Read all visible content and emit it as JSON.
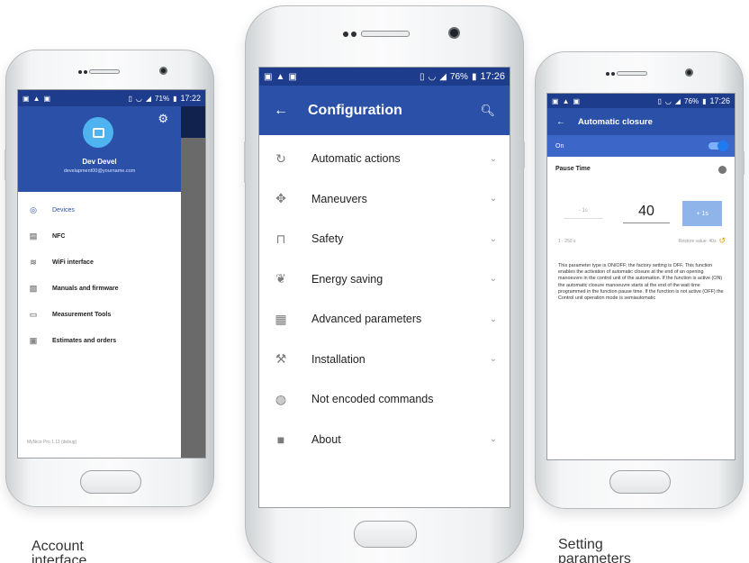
{
  "left_phone": {
    "status_time": "17:22",
    "status_battery": "71%",
    "user": {
      "name": "Dev Devel",
      "email": "develapment00@yourname.com"
    },
    "menu": [
      {
        "label": "Devices",
        "icon": "devices-icon",
        "active": true
      },
      {
        "label": "NFC",
        "icon": "nfc-icon",
        "active": false
      },
      {
        "label": "WiFi interface",
        "icon": "wifi-icon",
        "active": false
      },
      {
        "label": "Manuals and firmware",
        "icon": "manuals-icon",
        "active": false
      },
      {
        "label": "Measurement Tools",
        "icon": "ruler-icon",
        "active": false
      },
      {
        "label": "Estimates and orders",
        "icon": "orders-icon",
        "active": false
      }
    ],
    "version": "MyNice Pro 1.11 (debug)"
  },
  "center_phone": {
    "status_time": "17:26",
    "status_battery": "76%",
    "title": "Configuration",
    "items": [
      {
        "label": "Automatic actions",
        "icon": "sync-icon",
        "chevron": true
      },
      {
        "label": "Maneuvers",
        "icon": "move-icon",
        "chevron": true
      },
      {
        "label": "Safety",
        "icon": "lock-icon",
        "chevron": true
      },
      {
        "label": "Energy saving",
        "icon": "leaf-icon",
        "chevron": true
      },
      {
        "label": "Advanced parameters",
        "icon": "sliders-icon",
        "chevron": true
      },
      {
        "label": "Installation",
        "icon": "wrench-icon",
        "chevron": true
      },
      {
        "label": "Not encoded commands",
        "icon": "globe-icon",
        "chevron": false
      },
      {
        "label": "About",
        "icon": "folder-icon",
        "chevron": true
      }
    ]
  },
  "right_phone": {
    "status_time": "17:26",
    "status_battery": "76%",
    "title": "Automatic closure",
    "on_label": "On",
    "toggle_on": true,
    "pause_label": "Pause Time",
    "minus_label": "- 1s",
    "value": "40",
    "plus_label": "+ 1s",
    "range": "1 - 250 s",
    "restore_label": "Restore value: 40s",
    "description": "This parameter type is ON/OFF; the factory setting is OFF. This function enables the activation of automatic closure at the end of an opening manoeuvre in the control unit of the automation. If the function is active (ON) the automatic closure manoeuvre starts at the end of the wait time programmed in the function pause time. If the function is not active (OFF) the Control unit operation mode is semiautomatic"
  },
  "captions": {
    "left": [
      "Account",
      "interface"
    ],
    "right": [
      "Setting",
      "parameters"
    ]
  }
}
